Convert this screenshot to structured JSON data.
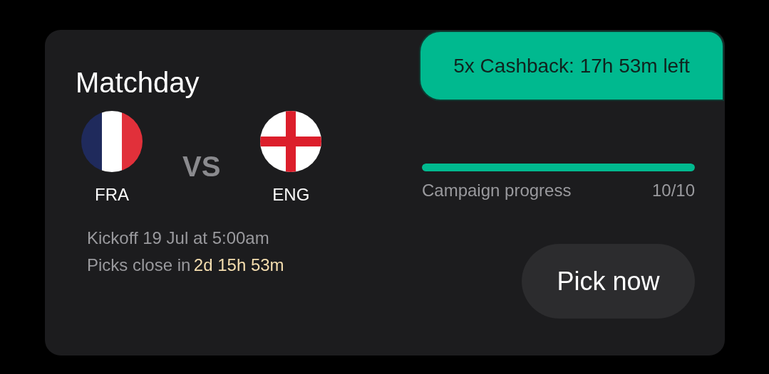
{
  "promo_badge": {
    "text": "5x Cashback: 17h 53m left"
  },
  "title": "Matchday",
  "teams": [
    {
      "code": "FRA",
      "kind": "tricolor"
    },
    {
      "code": "ENG",
      "kind": "cross"
    }
  ],
  "versus": "VS",
  "kickoff": "Kickoff 19 Jul at 5:00am",
  "picks_close": {
    "label": "Picks close in",
    "countdown": "2d 15h 53m"
  },
  "campaign": {
    "label": "Campaign progress",
    "count": "10/10",
    "level": 1
  },
  "button": "Pick now"
}
